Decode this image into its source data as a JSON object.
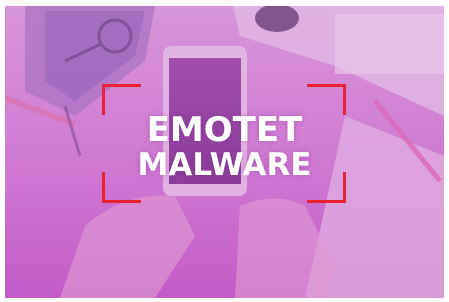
{
  "banner": {
    "title_line1": "EMOTET",
    "title_line2": "MALWARE"
  },
  "colors": {
    "overlay_top": "#d59ad8",
    "overlay_bottom": "#c85cc8",
    "bracket": "#e8222e",
    "text": "#ffffff"
  }
}
